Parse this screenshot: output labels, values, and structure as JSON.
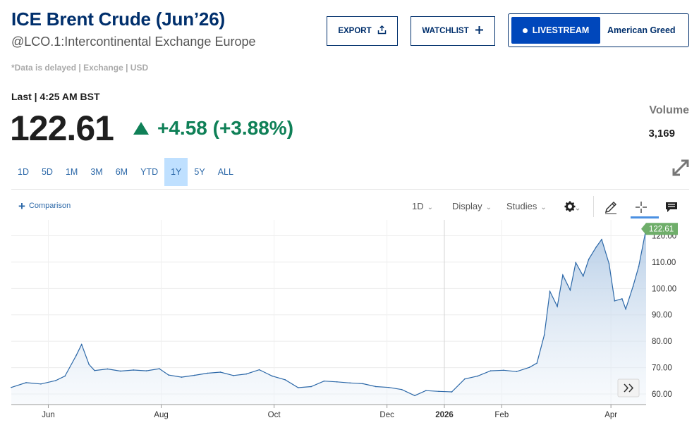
{
  "header": {
    "title": "ICE Brent Crude (Jun’26)",
    "subtitle": "@LCO.1:Intercontinental Exchange Europe",
    "delayed_note": "*Data is delayed | Exchange | USD"
  },
  "actions": {
    "export_label": "EXPORT",
    "watchlist_label": "WATCHLIST",
    "live_label": "LIVESTREAM",
    "live_show": "American Greed"
  },
  "quote": {
    "last_label": "Last | 4:25 AM BST",
    "price": "122.61",
    "change": "+4.58 (+3.88%)",
    "direction": "up",
    "up_color": "#0f8057",
    "volume_label": "Volume",
    "volume_value": "3,169"
  },
  "ranges": {
    "items": [
      "1D",
      "5D",
      "1M",
      "3M",
      "6M",
      "YTD",
      "1Y",
      "5Y",
      "ALL"
    ],
    "active": "1Y"
  },
  "toolbar": {
    "comparison_label": "Comparison",
    "interval_label": "1D",
    "display_label": "Display",
    "studies_label": "Studies",
    "icons": [
      "gear-icon",
      "pencil-icon",
      "crosshair-icon",
      "comment-icon"
    ]
  },
  "chart_data": {
    "type": "area",
    "y_ticks": [
      "60.00",
      "70.00",
      "80.00",
      "90.00",
      "100.00",
      "110.00",
      "120.00"
    ],
    "x_labels": [
      "Jun",
      "Aug",
      "Oct",
      "Dec",
      "2026",
      "Feb",
      "Apr"
    ],
    "ylim": [
      56,
      126
    ],
    "last_price_label": "122.61",
    "last_price_color": "#6fae6a",
    "line_color": "#2c68a8",
    "grid": true,
    "x": [
      "2025-05-12",
      "2025-05-20",
      "2025-05-28",
      "2025-06-05",
      "2025-06-10",
      "2025-06-16",
      "2025-06-19",
      "2025-06-23",
      "2025-06-26",
      "2025-07-03",
      "2025-07-10",
      "2025-07-17",
      "2025-07-24",
      "2025-07-31",
      "2025-08-05",
      "2025-08-12",
      "2025-08-19",
      "2025-08-26",
      "2025-09-02",
      "2025-09-09",
      "2025-09-16",
      "2025-09-23",
      "2025-09-30",
      "2025-10-07",
      "2025-10-14",
      "2025-10-21",
      "2025-10-28",
      "2025-11-04",
      "2025-11-11",
      "2025-11-18",
      "2025-11-25",
      "2025-12-02",
      "2025-12-09",
      "2025-12-16",
      "2025-12-22",
      "2025-12-29",
      "2026-01-05",
      "2026-01-12",
      "2026-01-19",
      "2026-01-26",
      "2026-02-02",
      "2026-02-09",
      "2026-02-16",
      "2026-02-20",
      "2026-02-24",
      "2026-02-27",
      "2026-03-03",
      "2026-03-06",
      "2026-03-10",
      "2026-03-13",
      "2026-03-17",
      "2026-03-20",
      "2026-03-24",
      "2026-03-27",
      "2026-03-31",
      "2026-04-03",
      "2026-04-07",
      "2026-04-09",
      "2026-04-13",
      "2026-04-16",
      "2026-04-20"
    ],
    "values": [
      62.5,
      64.3,
      63.8,
      65.1,
      66.8,
      74.5,
      78.8,
      71.2,
      68.9,
      69.5,
      68.7,
      69.1,
      68.8,
      69.6,
      67.2,
      66.4,
      67.1,
      67.9,
      68.3,
      67.0,
      67.6,
      69.2,
      66.8,
      65.4,
      62.4,
      62.8,
      64.9,
      64.6,
      64.2,
      63.9,
      62.8,
      62.5,
      61.7,
      59.4,
      61.3,
      61.0,
      60.8,
      65.7,
      66.8,
      68.8,
      69.0,
      68.5,
      70.1,
      71.7,
      82.4,
      98.9,
      93.2,
      105.1,
      99.4,
      109.8,
      104.7,
      111.1,
      115.7,
      118.6,
      109.4,
      95.3,
      96.1,
      92.2,
      100.9,
      108.3,
      122.61
    ]
  }
}
